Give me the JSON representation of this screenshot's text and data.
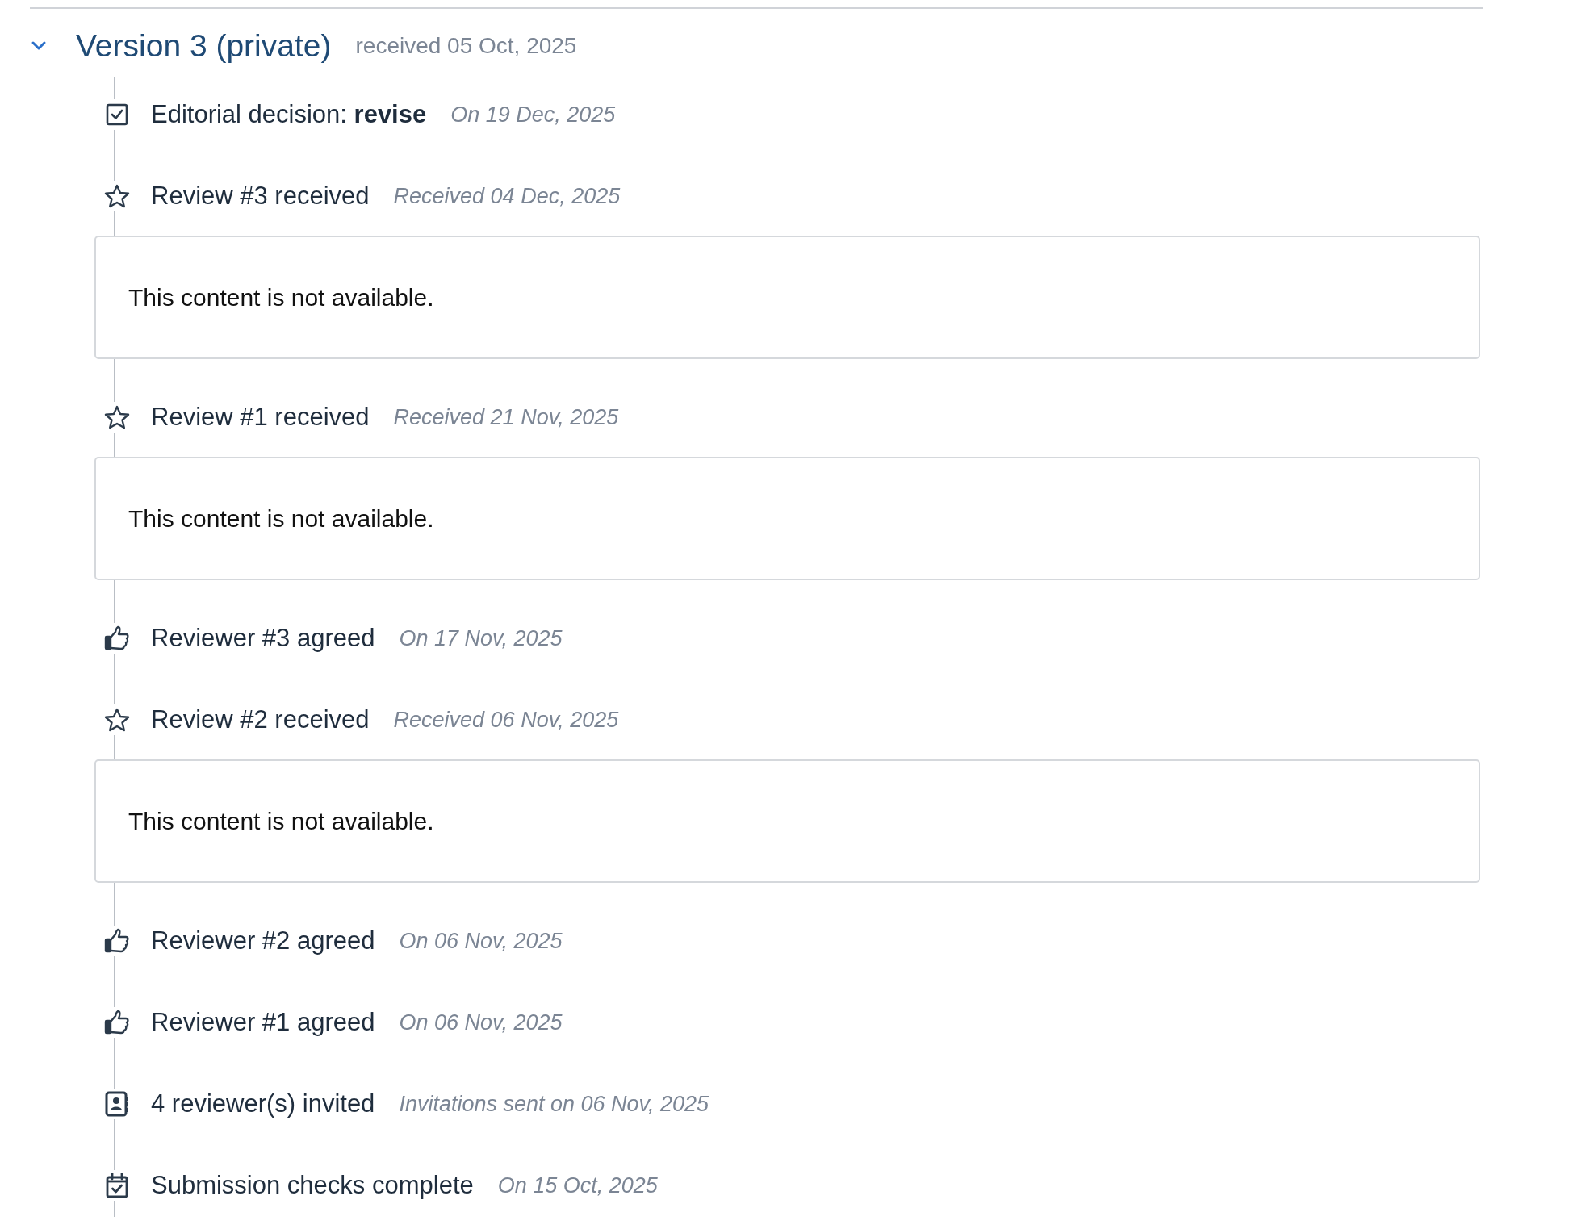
{
  "version": {
    "title": "Version 3 (private)",
    "received": "received 05 Oct, 2025",
    "expanded": true
  },
  "events": [
    {
      "kind": "decision",
      "text": "Editorial decision: **revise**",
      "date": "On 19 Dec, 2025"
    },
    {
      "kind": "review",
      "text": "Review #3 received",
      "date": "Received 04 Dec, 2025",
      "content": "This content is not available."
    },
    {
      "kind": "review",
      "text": "Review #1 received",
      "date": "Received 21 Nov, 2025",
      "content": "This content is not available."
    },
    {
      "kind": "agreed",
      "text": "Reviewer #3 agreed",
      "date": "On 17 Nov, 2025"
    },
    {
      "kind": "review",
      "text": "Review #2 received",
      "date": "Received 06 Nov, 2025",
      "content": "This content is not available."
    },
    {
      "kind": "agreed",
      "text": "Reviewer #2 agreed",
      "date": "On 06 Nov, 2025"
    },
    {
      "kind": "agreed",
      "text": "Reviewer #1 agreed",
      "date": "On 06 Nov, 2025"
    },
    {
      "kind": "invited",
      "text": "4 reviewer(s) invited",
      "date": "Invitations sent on 06 Nov, 2025"
    },
    {
      "kind": "checks",
      "text": "Submission checks complete",
      "date": "On 15 Oct, 2025"
    }
  ]
}
